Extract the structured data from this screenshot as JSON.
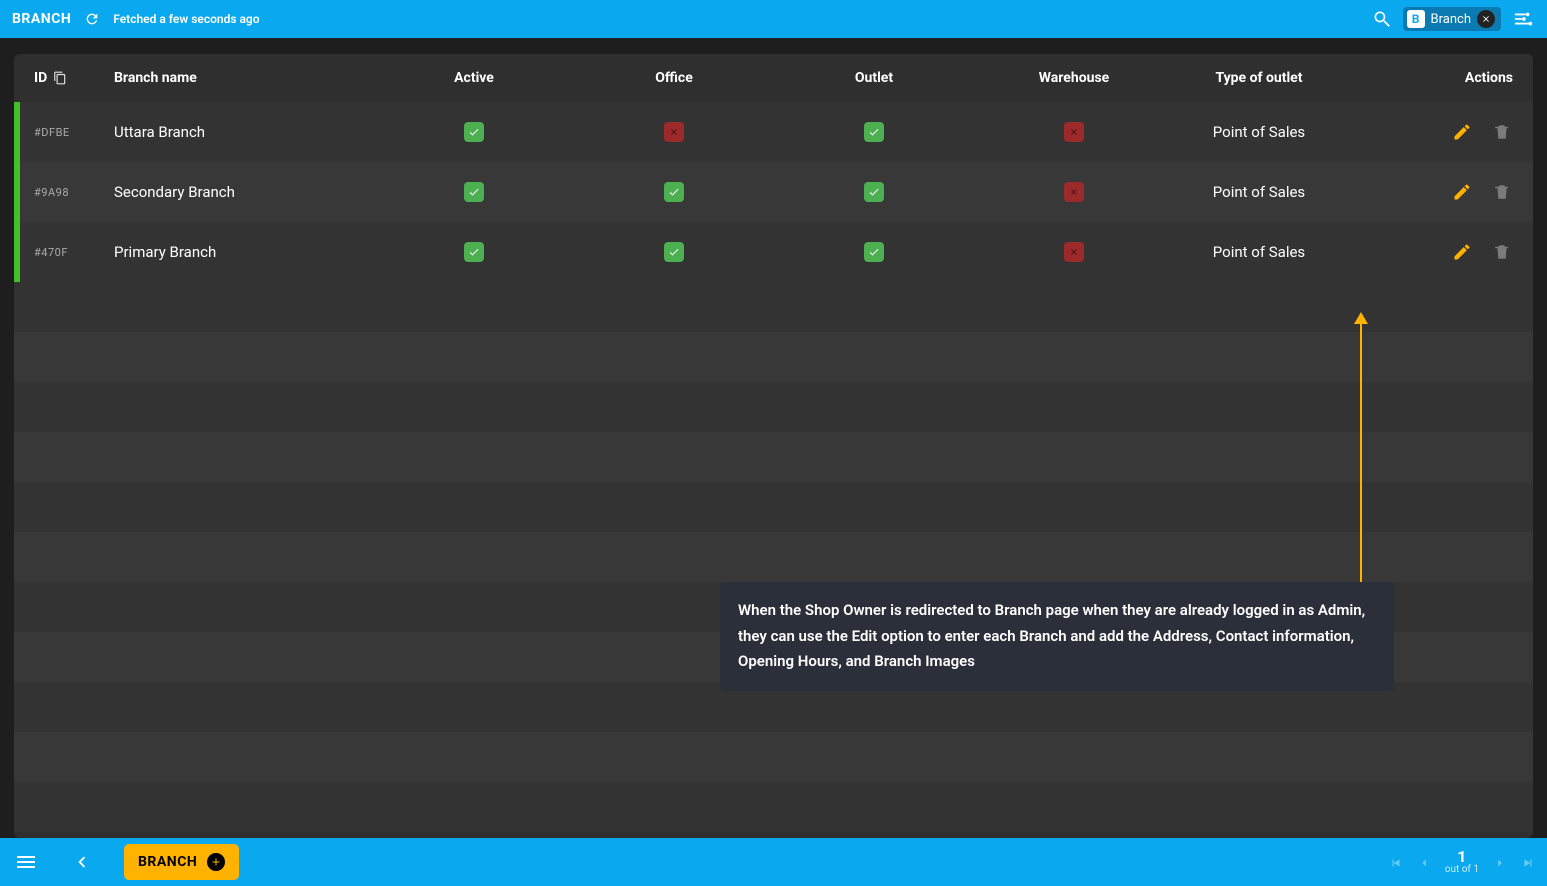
{
  "topbar": {
    "title": "BRANCH",
    "fetched_text": "Fetched a few seconds ago",
    "filter_chip": {
      "badge": "B",
      "label": "Branch"
    }
  },
  "table": {
    "columns": {
      "id": "ID",
      "name": "Branch name",
      "active": "Active",
      "office": "Office",
      "outlet": "Outlet",
      "warehouse": "Warehouse",
      "type": "Type of outlet",
      "actions": "Actions"
    },
    "rows": [
      {
        "id": "#DFBE",
        "name": "Uttara Branch",
        "active": true,
        "office": false,
        "outlet": true,
        "warehouse": false,
        "type": "Point of Sales"
      },
      {
        "id": "#9A98",
        "name": "Secondary Branch",
        "active": true,
        "office": true,
        "outlet": true,
        "warehouse": false,
        "type": "Point of Sales"
      },
      {
        "id": "#470F",
        "name": "Primary Branch",
        "active": true,
        "office": true,
        "outlet": true,
        "warehouse": false,
        "type": "Point of Sales"
      }
    ]
  },
  "annotation": {
    "text": "When the Shop Owner is redirected to Branch page when they are already logged in as Admin, they can use the Edit option to enter each Branch and add the Address, Contact information, Opening Hours, and Branch Images"
  },
  "bottombar": {
    "button_label": "BRANCH",
    "page_current": "1",
    "page_total": "out of 1"
  }
}
